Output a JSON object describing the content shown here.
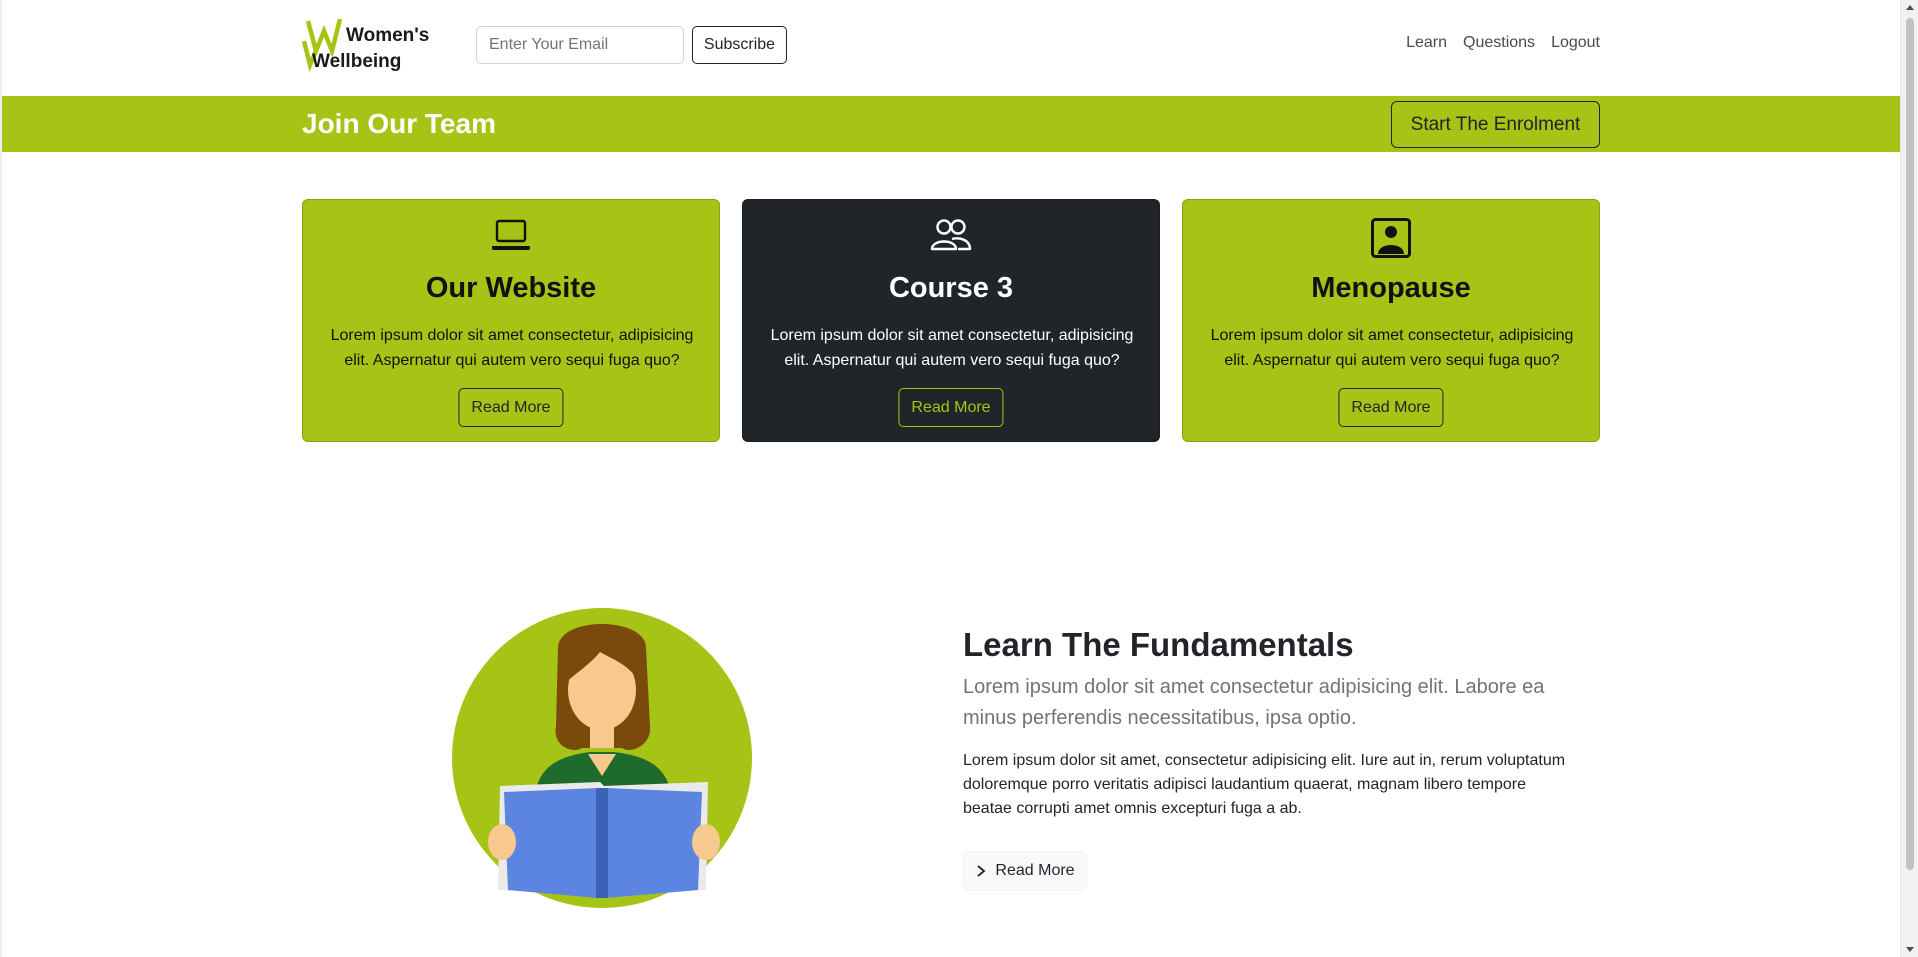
{
  "header": {
    "logo_text_line1": "Women's",
    "logo_text_line2": "Wellbeing",
    "email_placeholder": "Enter Your Email",
    "email_value": "",
    "subscribe_label": "Subscribe",
    "nav": [
      "Learn",
      "Questions",
      "Logout"
    ]
  },
  "banner": {
    "title": "Join Our Team",
    "enrol_label": "Start The Enrolment"
  },
  "cards": [
    {
      "icon": "laptop-icon",
      "title": "Our Website",
      "text": "Lorem ipsum dolor sit amet consectetur, adipisicing elit. Aspernatur qui autem vero sequi fuga quo?",
      "button": "Read More",
      "theme": "green"
    },
    {
      "icon": "people-icon",
      "title": "Course 3",
      "text": "Lorem ipsum dolor sit amet consectetur, adipisicing elit. Aspernatur qui autem vero sequi fuga quo?",
      "button": "Read More",
      "theme": "dark"
    },
    {
      "icon": "person-square-icon",
      "title": "Menopause",
      "text": "Lorem ipsum dolor sit amet consectetur, adipisicing elit. Aspernatur qui autem vero sequi fuga quo?",
      "button": "Read More",
      "theme": "green"
    }
  ],
  "feature": {
    "image": "woman-reading-book-illustration",
    "title": "Learn The Fundamentals",
    "lead": "Lorem ipsum dolor sit amet consectetur adipisicing elit. Labore ea minus perferendis necessitatibus, ipsa optio.",
    "body": "Lorem ipsum dolor sit amet, consectetur adipisicing elit. Iure aut in, rerum voluptatum doloremque porro veritatis adipisci laudantium quaerat, magnam libero tempore beatae corrupti amet omnis excepturi fuga a ab.",
    "button": "Read More",
    "button_icon": "chevron-right-icon"
  },
  "colors": {
    "brand_green": "#a6c416",
    "dark": "#212529",
    "muted": "#6c757d"
  }
}
